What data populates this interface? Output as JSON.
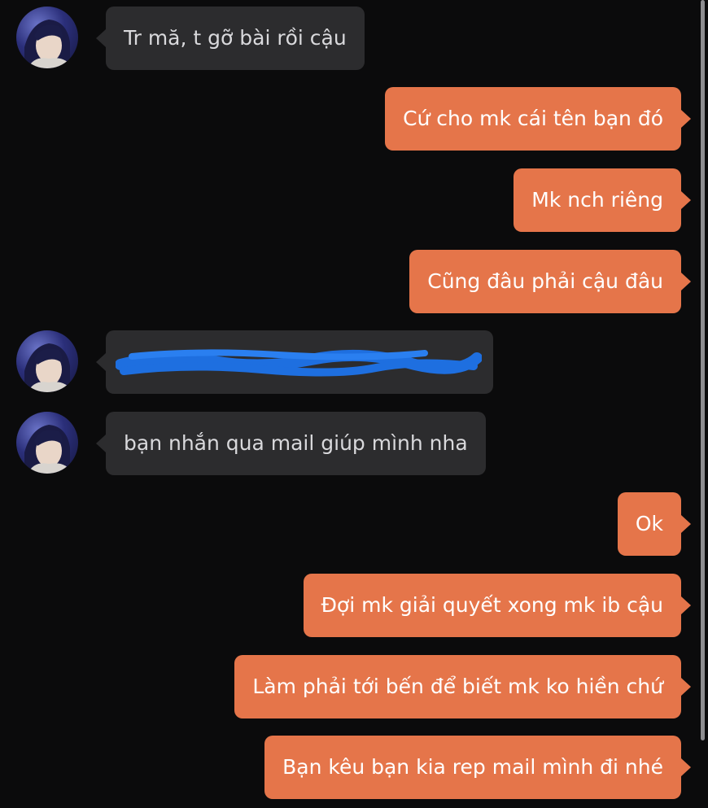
{
  "colors": {
    "background": "#0b0b0c",
    "incoming_bubble": "#2c2c2e",
    "outgoing_bubble": "#e5754a",
    "redaction": "#1e6fe0"
  },
  "messages": [
    {
      "direction": "incoming",
      "text": "Tr mă, t gỡ bài rồi cậu"
    },
    {
      "direction": "outgoing",
      "text": "Cứ cho mk cái tên bạn đó"
    },
    {
      "direction": "outgoing",
      "text": "Mk nch riêng"
    },
    {
      "direction": "outgoing",
      "text": "Cũng đâu phải cậu đâu"
    },
    {
      "direction": "incoming",
      "text": "",
      "redacted": true
    },
    {
      "direction": "incoming",
      "text": "bạn nhắn qua mail giúp mình nha"
    },
    {
      "direction": "outgoing",
      "text": "Ok"
    },
    {
      "direction": "outgoing",
      "text": "Đợi mk giải quyết xong mk ib cậu"
    },
    {
      "direction": "outgoing",
      "text": "Làm phải tới bến để biết mk ko hiền chứ"
    },
    {
      "direction": "outgoing",
      "text": "Bạn kêu bạn kia rep mail mình đi nhé"
    }
  ]
}
